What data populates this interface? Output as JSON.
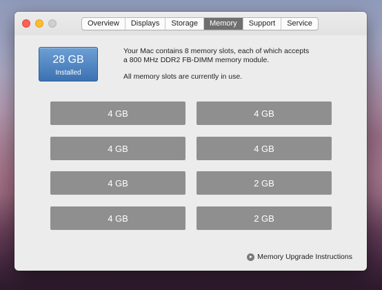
{
  "window": {
    "tabs": [
      {
        "label": "Overview",
        "active": false
      },
      {
        "label": "Displays",
        "active": false
      },
      {
        "label": "Storage",
        "active": false
      },
      {
        "label": "Memory",
        "active": true
      },
      {
        "label": "Support",
        "active": false
      },
      {
        "label": "Service",
        "active": false
      }
    ]
  },
  "memory": {
    "installed_size": "28 GB",
    "installed_label": "Installed",
    "info_line1": "Your Mac contains 8 memory slots, each of which accepts",
    "info_line2": "a 800 MHz DDR2 FB-DIMM memory module.",
    "info_status": "All memory slots are currently in use.",
    "slots": [
      "4 GB",
      "4 GB",
      "4 GB",
      "4 GB",
      "4 GB",
      "2 GB",
      "4 GB",
      "2 GB"
    ],
    "upgrade_link": "Memory Upgrade Instructions"
  },
  "colors": {
    "installed_badge": "#3d72b3",
    "slot": "#8f8f8f",
    "active_tab": "#6f6f6f"
  }
}
